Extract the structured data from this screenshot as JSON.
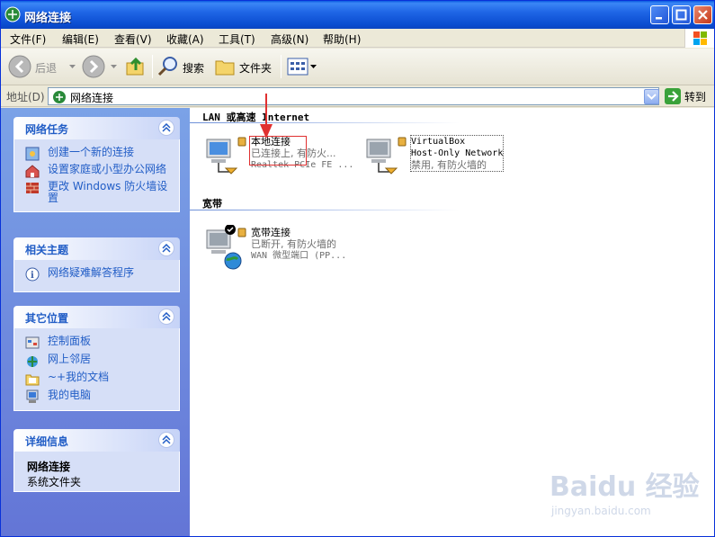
{
  "window": {
    "title": "网络连接"
  },
  "menu": [
    "文件(F)",
    "编辑(E)",
    "查看(V)",
    "收藏(A)",
    "工具(T)",
    "高级(N)",
    "帮助(H)"
  ],
  "toolbar": {
    "back": "后退",
    "search": "搜索",
    "folders": "文件夹"
  },
  "address": {
    "label": "地址(D)",
    "value": "网络连接",
    "go": "转到"
  },
  "left": {
    "network_tasks": {
      "title": "网络任务",
      "items": [
        "创建一个新的连接",
        "设置家庭或小型办公网络",
        "更改 Windows 防火墙设置"
      ]
    },
    "related": {
      "title": "相关主题",
      "items": [
        "网络疑难解答程序"
      ]
    },
    "other_places": {
      "title": "其它位置",
      "items": [
        "控制面板",
        "网上邻居",
        "~+我的文档",
        "我的电脑"
      ]
    },
    "details": {
      "title": "详细信息",
      "name": "网络连接",
      "type": "系统文件夹"
    }
  },
  "groups": {
    "lan": {
      "header": "LAN 或高速 Internet",
      "connections": [
        {
          "name": "本地连接",
          "status": "已连接上, 有防火...",
          "device": "Realtek PCIe FE ..."
        },
        {
          "name": "VirtualBox",
          "status": "Host-Only Network",
          "device": "禁用, 有防火墙的"
        }
      ]
    },
    "broadband": {
      "header": "宽带",
      "connections": [
        {
          "name": "宽带连接",
          "status": "已断开, 有防火墙的",
          "device": "WAN 微型端口 (PP..."
        }
      ]
    }
  },
  "watermark": {
    "brand": "Baidu 经验",
    "url": "jingyan.baidu.com"
  },
  "colors": {
    "title_bar": "#1f66e6",
    "task_link": "#215dc6",
    "highlight": "#e03030"
  }
}
